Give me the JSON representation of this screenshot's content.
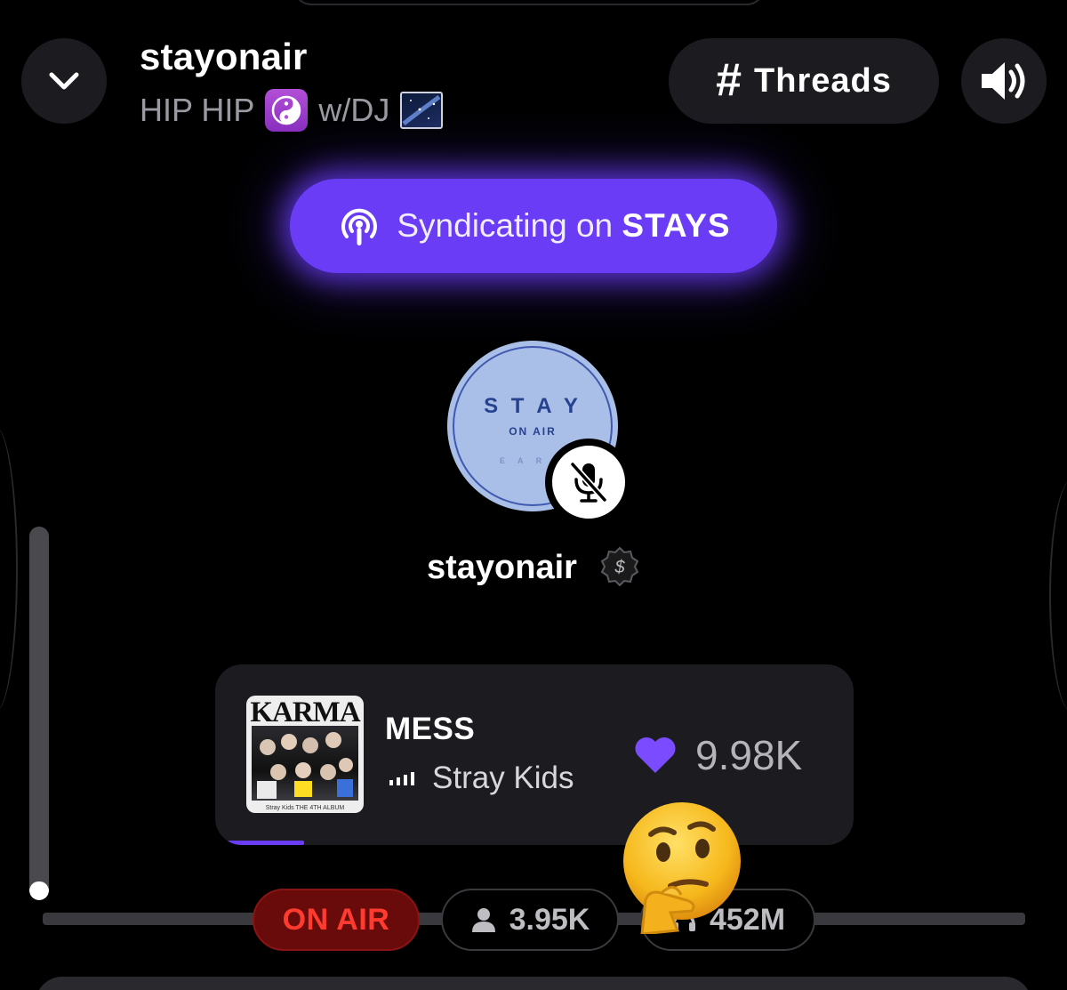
{
  "header": {
    "title": "stayonair",
    "subtitle_prefix": "HIP HIP",
    "subtitle_suffix": "w/DJ",
    "threads_hash": "#",
    "threads_label": "Threads"
  },
  "syndicate": {
    "prefix": "Syndicating on ",
    "brand": "STAYS"
  },
  "avatar": {
    "logo_main": "S T A Y",
    "logo_sub": "ON AIR",
    "logo_small": "E A R N"
  },
  "host": {
    "name": "stayonair",
    "badge_symbol": "$"
  },
  "volume": {
    "level": 0.05
  },
  "now_playing": {
    "album_title": "KARMA",
    "album_caption": "Stray Kids THE 4TH ALBUM",
    "song": "MESS",
    "artist": "Stray Kids",
    "likes": "9.98K",
    "progress": 0.12
  },
  "status": {
    "on_air": "ON AIR",
    "listeners": "3.95K",
    "plays": "452M"
  },
  "colors": {
    "accent": "#6a3cf6",
    "on_air_text": "#ff3b30",
    "on_air_bg": "#6a0b0b",
    "card_bg": "#1c1c20"
  }
}
